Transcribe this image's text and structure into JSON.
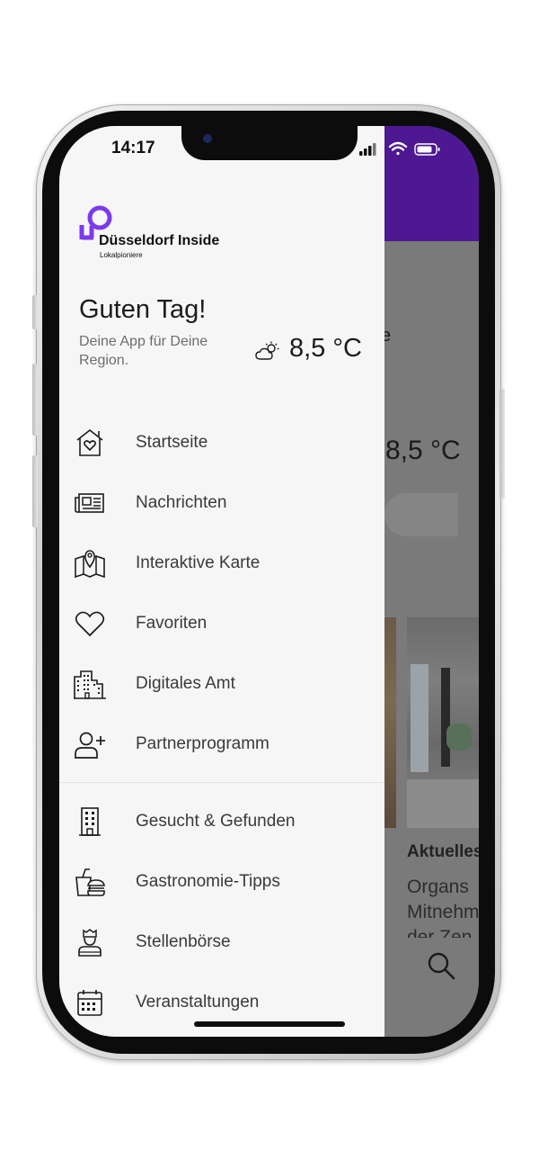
{
  "status_bar": {
    "time": "14:17"
  },
  "colors": {
    "brand": "#7c3aed",
    "header": "#4d1891",
    "drawer_bg": "#f6f6f6",
    "overlay": "#7a7a7a"
  },
  "drawer": {
    "logo": {
      "title": "Düsseldorf Inside",
      "subtitle": "Lokalpioniere"
    },
    "greeting": "Guten Tag!",
    "tagline": "Deine App für Deine Region.",
    "weather": {
      "icon": "partly-cloudy-icon",
      "temperature": "8,5 °C"
    },
    "menu": [
      {
        "label": "Startseite",
        "icon": "home-heart-icon"
      },
      {
        "label": "Nachrichten",
        "icon": "newspaper-icon"
      },
      {
        "label": "Interaktive Karte",
        "icon": "map-icon"
      },
      {
        "label": "Favoriten",
        "icon": "heart-icon"
      },
      {
        "label": "Digitales Amt",
        "icon": "city-buildings-icon"
      },
      {
        "label": "Partnerprogramm",
        "icon": "add-user-icon"
      },
      {
        "label": "Gesucht & Gefunden",
        "icon": "building-icon"
      },
      {
        "label": "Gastronomie-Tipps",
        "icon": "burger-drink-icon"
      },
      {
        "label": "Stellenbörse",
        "icon": "worker-icon"
      },
      {
        "label": "Veranstaltungen",
        "icon": "calendar-icon"
      }
    ]
  },
  "background_app": {
    "temperature": "8,5 °C",
    "dot": "e",
    "card_title": "Aktuelles",
    "card_text_lines": [
      "Organs",
      "Mitnehm",
      "der Zen"
    ]
  }
}
